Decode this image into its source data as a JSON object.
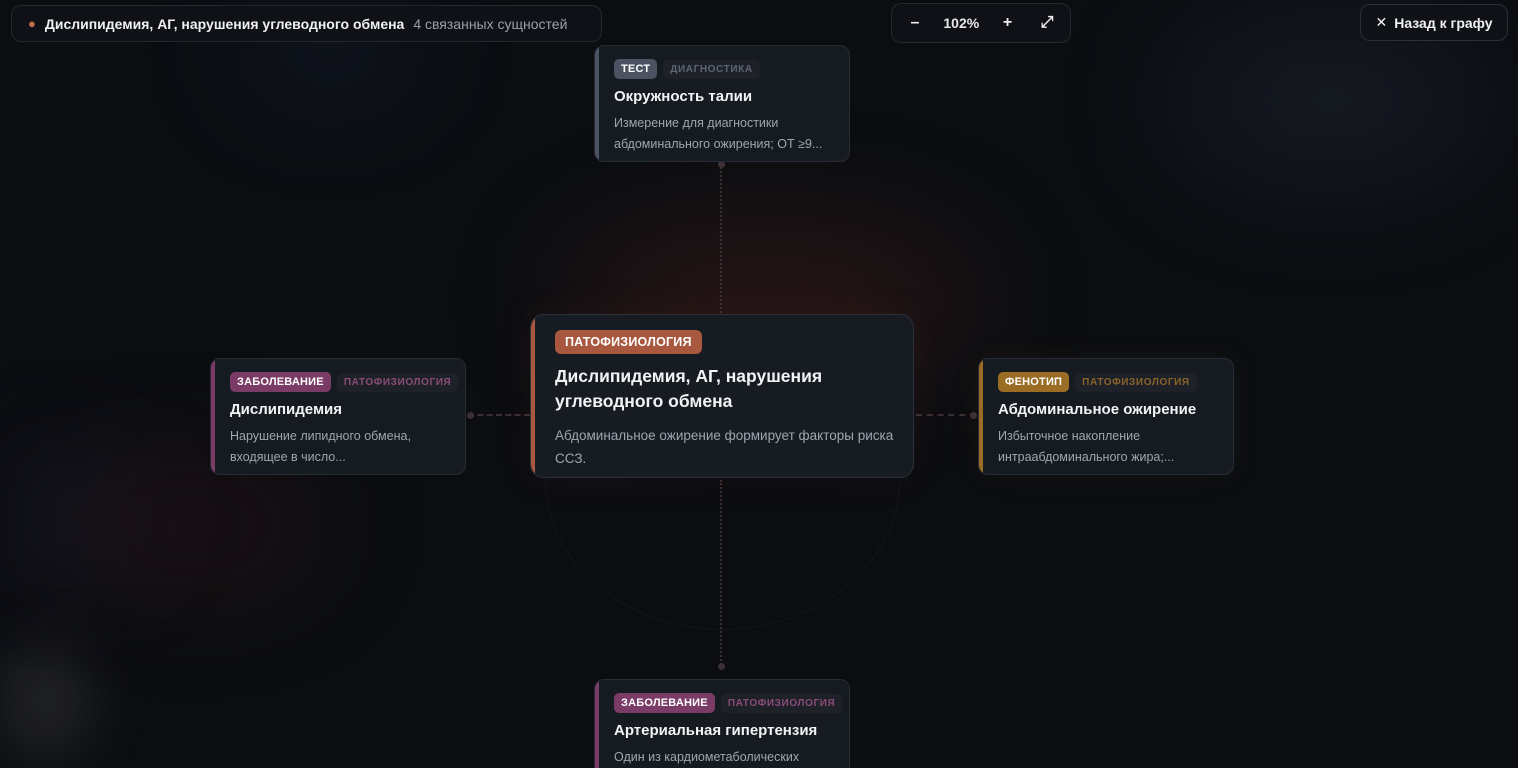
{
  "header": {
    "bullet": "●",
    "title": "Дислипидемия, АГ, нарушения углеводного обмена",
    "related_count": "4 связанных сущностей"
  },
  "zoom": {
    "minus": "–",
    "value": "102%",
    "plus": "+",
    "fit": "⤢"
  },
  "back": {
    "icon": "✕",
    "label": "Назад к графу"
  },
  "center": {
    "tag": "ПАТОФИЗИОЛОГИЯ",
    "title": "Дислипидемия, АГ, нарушения углеводного обмена",
    "desc": "Абдоминальное ожирение формирует факторы риска ССЗ.",
    "color": "#a8583e"
  },
  "nodes": {
    "top": {
      "tag": "ТЕСТ",
      "sub": "ДИАГНОСТИКА",
      "title": "Окружность талии",
      "desc": "Измерение для диагностики абдоминального ожирения; ОТ ≥9...",
      "color": "#4b5262"
    },
    "left": {
      "tag": "ЗАБОЛЕВАНИЕ",
      "sub": "ПАТОФИЗИОЛОГИЯ",
      "title": "Дислипидемия",
      "desc": "Нарушение липидного обмена, входящее в число...",
      "color": "#7a3b66"
    },
    "right": {
      "tag": "ФЕНОТИП",
      "sub": "ПАТОФИЗИОЛОГИЯ",
      "title": "Абдоминальное ожирение",
      "desc": "Избыточное накопление интраабдоминального жира;...",
      "color": "#9a6c24"
    },
    "bottom": {
      "tag": "ЗАБОЛЕВАНИЕ",
      "sub": "ПАТОФИЗИОЛОГИЯ",
      "title": "Артериальная гипертензия",
      "desc": "Один из кардиометаболических",
      "color": "#7a3b66"
    }
  }
}
